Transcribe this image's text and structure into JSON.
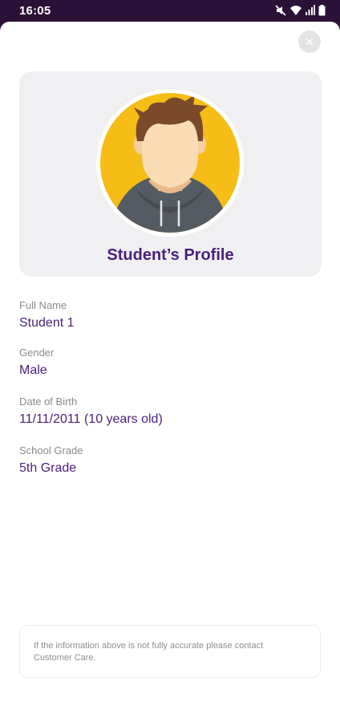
{
  "status_bar": {
    "time": "16:05",
    "icons": [
      "mute-icon",
      "wifi-icon",
      "signal-icon",
      "battery-icon"
    ]
  },
  "close_button": {
    "icon": "close-icon"
  },
  "profile": {
    "title": "Student’s Profile",
    "avatar": "avatar-boy-icon"
  },
  "fields": [
    {
      "label": "Full Name",
      "value": "Student 1"
    },
    {
      "label": "Gender",
      "value": "Male"
    },
    {
      "label": "Date of Birth",
      "value": "11/11/2011 (10 years old)"
    },
    {
      "label": "School Grade",
      "value": "5th Grade"
    }
  ],
  "info": {
    "text": "If the information above is not fully accurate please contact Customer Care."
  },
  "colors": {
    "status_bar": "#2b1038",
    "accent": "#4a1f79",
    "avatar_bg": "#f6bd16"
  }
}
